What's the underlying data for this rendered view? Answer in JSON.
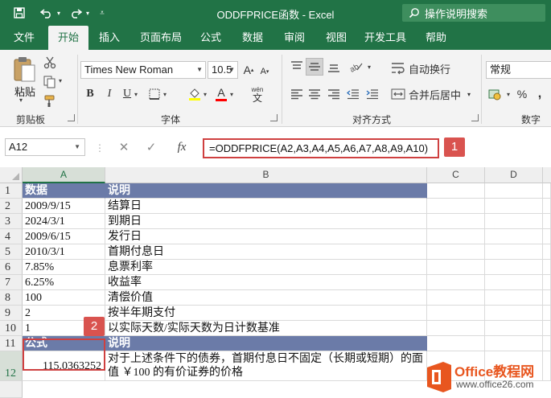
{
  "title_bar": {
    "doc_title": "ODDFPRICE函数 - Excel",
    "tell_me": "操作说明搜索"
  },
  "tabs": [
    "文件",
    "开始",
    "插入",
    "页面布局",
    "公式",
    "数据",
    "审阅",
    "视图",
    "开发工具",
    "帮助"
  ],
  "active_tab": "开始",
  "ribbon": {
    "paste_label": "粘贴",
    "clipboard_label": "剪贴板",
    "font_name": "Times New Roman",
    "font_size": "10.5",
    "bold": "B",
    "italic": "I",
    "underline": "U",
    "font_group_label": "字体",
    "wen": "wén",
    "wrap_text": "自动换行",
    "merge_center": "合并后居中",
    "align_group_label": "对齐方式",
    "number_format": "常规",
    "number_group_label": "数字",
    "percent": "%",
    "comma": ","
  },
  "formula_bar": {
    "name_box": "A12",
    "fx": "fx",
    "formula": "=ODDFPRICE(A2,A3,A4,A5,A6,A7,A8,A9,A10)"
  },
  "badges": [
    "1",
    "2"
  ],
  "columns": [
    "A",
    "B",
    "C",
    "D"
  ],
  "rows": [
    {
      "n": "1",
      "a": "数据",
      "b": "说明"
    },
    {
      "n": "2",
      "a": "2009/9/15",
      "b": "结算日"
    },
    {
      "n": "3",
      "a": "2024/3/1",
      "b": "到期日"
    },
    {
      "n": "4",
      "a": "2009/6/15",
      "b": "发行日"
    },
    {
      "n": "5",
      "a": "2010/3/1",
      "b": "首期付息日"
    },
    {
      "n": "6",
      "a": "7.85%",
      "b": "息票利率"
    },
    {
      "n": "7",
      "a": "6.25%",
      "b": "收益率"
    },
    {
      "n": "8",
      "a": "100",
      "b": "清偿价值"
    },
    {
      "n": "9",
      "a": "2",
      "b": "按半年期支付"
    },
    {
      "n": "10",
      "a": "1",
      "b": "以实际天数/实际天数为日计数基准"
    },
    {
      "n": "11",
      "a": "公式",
      "b": "说明"
    },
    {
      "n": "12",
      "a": "115.0363252",
      "b": "对于上述条件下的债券，首期付息日不固定（长期或短期）的面值 ￥100 的有价证券的价格"
    }
  ],
  "logo": {
    "brand": "Office教程网",
    "url": "www.office26.com"
  },
  "colors": {
    "excel_green": "#217346",
    "header_fill": "#6b7ba8",
    "highlight_red": "#cf4040",
    "logo_orange": "#e8561f"
  }
}
